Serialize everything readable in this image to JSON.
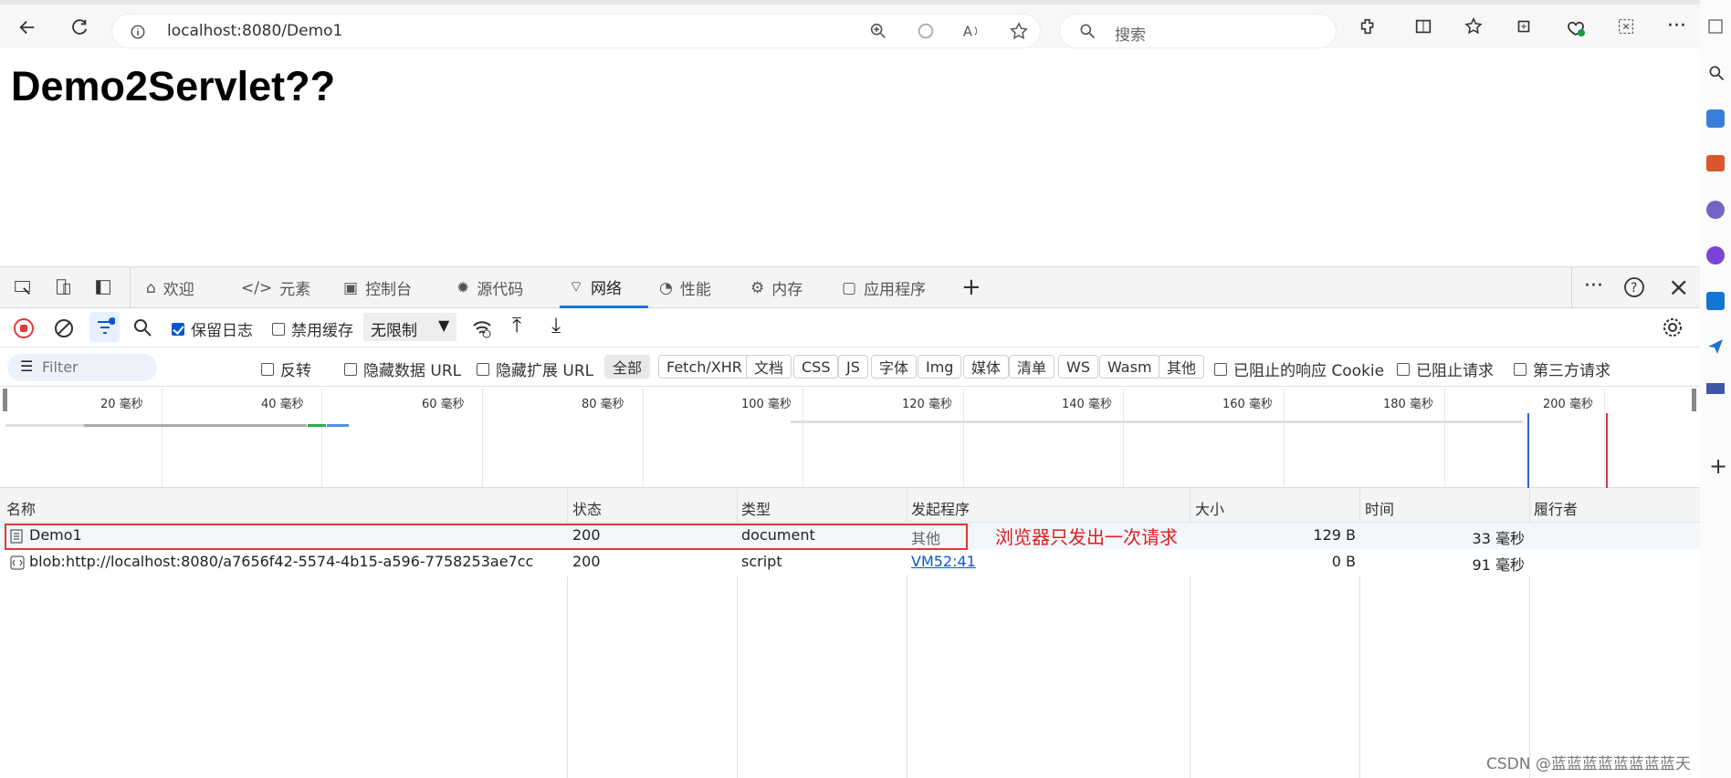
{
  "browser": {
    "address": "localhost:8080/Demo1",
    "search_placeholder": "搜索"
  },
  "page": {
    "heading": "Demo2Servlet??"
  },
  "devtools": {
    "tabs": [
      {
        "label": "欢迎",
        "icon": "home-icon"
      },
      {
        "label": "元素",
        "icon": "code-icon"
      },
      {
        "label": "控制台",
        "icon": "terminal-icon"
      },
      {
        "label": "源代码",
        "icon": "bug-icon"
      },
      {
        "label": "网络",
        "icon": "wifi-icon",
        "active": true
      },
      {
        "label": "性能",
        "icon": "gauge-icon"
      },
      {
        "label": "内存",
        "icon": "chip-icon"
      },
      {
        "label": "应用程序",
        "icon": "app-icon"
      }
    ],
    "network_toolbar": {
      "preserve_log": "保留日志",
      "disable_cache": "禁用缓存",
      "throttle": "无限制"
    },
    "filters": {
      "placeholder": "Filter",
      "invert": "反转",
      "hide_data_url": "隐藏数据 URL",
      "hide_ext_url": "隐藏扩展 URL",
      "types": [
        "全部",
        "Fetch/XHR",
        "文档",
        "CSS",
        "JS",
        "字体",
        "Img",
        "媒体",
        "清单",
        "WS",
        "Wasm",
        "其他"
      ],
      "blocked_cookie": "已阻止的响应 Cookie",
      "blocked_requests": "已阻止请求",
      "third_party": "第三方请求"
    },
    "timeline": {
      "ticks": [
        "20 毫秒",
        "40 毫秒",
        "60 毫秒",
        "80 毫秒",
        "100 毫秒",
        "120 毫秒",
        "140 毫秒",
        "160 毫秒",
        "180 毫秒",
        "200 毫秒"
      ]
    },
    "columns": [
      "名称",
      "状态",
      "类型",
      "发起程序",
      "大小",
      "时间",
      "履行者"
    ],
    "requests": [
      {
        "name": "Demo1",
        "status": "200",
        "type": "document",
        "initiator": "其他",
        "size": "129 B",
        "time": "33 毫秒"
      },
      {
        "name": "blob:http://localhost:8080/a7656f42-5574-4b15-a596-7758253ae7cc",
        "status": "200",
        "type": "script",
        "initiator": "VM52:41",
        "size": "0 B",
        "time": "91 毫秒"
      }
    ]
  },
  "annotation": {
    "text": "浏览器只发出一次请求"
  },
  "watermark": "CSDN @蓝蓝蓝蓝蓝蓝蓝蓝天",
  "colors": {
    "accent": "#1a73e8",
    "annotation": "#e43535"
  }
}
